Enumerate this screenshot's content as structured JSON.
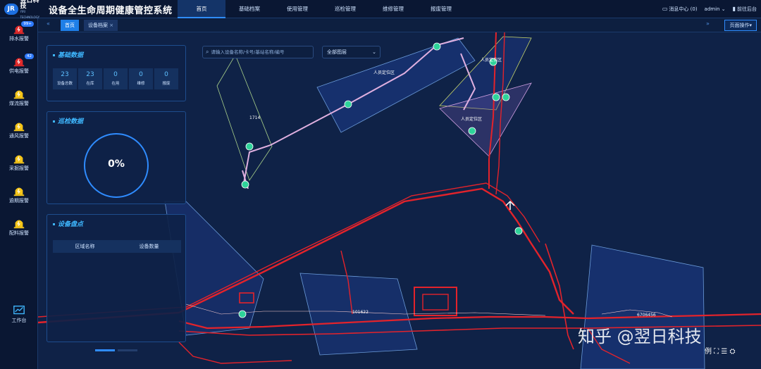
{
  "header": {
    "logo_mark": "JR",
    "logo_cn": "翌日科技",
    "logo_en": "YIRI TECHNOLOGY",
    "title": "设备全生命周期健康管控系统",
    "nav": [
      "首页",
      "基础档案",
      "使用管理",
      "巡检管理",
      "维修管理",
      "报废管理"
    ],
    "messages": "消息中心 (0)",
    "user": "admin",
    "goto_backend": "前往后台"
  },
  "sidebar": {
    "items": [
      {
        "label": "排水报警",
        "badge": "99+"
      },
      {
        "label": "供电报警",
        "badge": "42"
      },
      {
        "label": "煤流报警",
        "badge": ""
      },
      {
        "label": "通风报警",
        "badge": ""
      },
      {
        "label": "采掘报警",
        "badge": ""
      },
      {
        "label": "逾期报警",
        "badge": ""
      },
      {
        "label": "配料报警",
        "badge": ""
      }
    ],
    "workbench": "工作台"
  },
  "tabs": {
    "home": "首页",
    "archive": "设备档案",
    "close": "×",
    "page_op": "页面操作"
  },
  "basic": {
    "title": "基础数据",
    "stats": [
      {
        "value": "23",
        "label": "设备总数"
      },
      {
        "value": "23",
        "label": "在库"
      },
      {
        "value": "0",
        "label": "在用"
      },
      {
        "value": "0",
        "label": "维修"
      },
      {
        "value": "0",
        "label": "报废"
      }
    ]
  },
  "inspection": {
    "title": "巡检数据",
    "percent": "0%",
    "percent_value": 0
  },
  "inventory": {
    "title": "设备盘点",
    "col1": "区域名称",
    "col2": "设备数量"
  },
  "map": {
    "search_placeholder": "请输入设备名称/卡号/基站名称/编号",
    "layer": "全部图层",
    "labels": [
      "1714",
      "人员定位区",
      "人员定位区",
      "人员定位区",
      "101622",
      "6706456"
    ],
    "tools": "例 ⛶ ☰ ⛭"
  },
  "watermark": "知乎 @翌日科技",
  "colors": {
    "accent": "#2f8cff",
    "alarm_red": "#e12a2a",
    "alarm_yellow": "#f5c518",
    "route_red": "#e3232b",
    "station_green": "#2fd39a"
  }
}
